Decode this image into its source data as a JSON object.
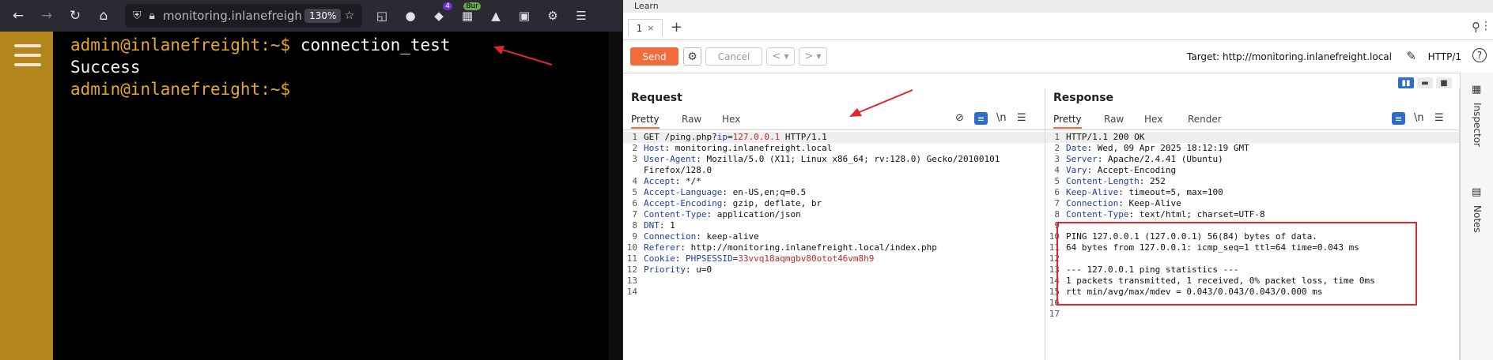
{
  "firefox": {
    "url": "monitoring.inlanefreigh",
    "zoom": "130%",
    "extensions": {
      "badge_count": "4",
      "burp_badge": "Bur"
    }
  },
  "terminal": {
    "lines": [
      {
        "prompt": "admin@inlanefreight:~$",
        "command": "connection_test"
      },
      {
        "output": "Success"
      },
      {
        "prompt": "admin@inlanefreight:~$",
        "command": ""
      }
    ]
  },
  "burp": {
    "learn_tab": "Learn",
    "repeater_tab": {
      "label": "1",
      "close": "×"
    },
    "add_tab": "+",
    "actions": {
      "send": "Send",
      "cancel": "Cancel",
      "prev": "<",
      "next": ">",
      "target": "Target: http://monitoring.inlanefreight.local",
      "protocol": "HTTP/1",
      "help": "?"
    },
    "request": {
      "title": "Request",
      "tabs": [
        "Pretty",
        "Raw",
        "Hex"
      ],
      "newline_toggle": "\\n",
      "lines": [
        {
          "n": "1",
          "parts": [
            {
              "t": "GET /ping.php?",
              "c": "val"
            },
            {
              "t": "ip",
              "c": "hdr"
            },
            {
              "t": "=",
              "c": "val"
            },
            {
              "t": "127.0.0.1",
              "c": "red"
            },
            {
              "t": " HTTP/1.1",
              "c": "val"
            }
          ]
        },
        {
          "n": "2",
          "parts": [
            {
              "t": "Host",
              "c": "hdr"
            },
            {
              "t": ": monitoring.inlanefreight.local",
              "c": "val"
            }
          ]
        },
        {
          "n": "3",
          "parts": [
            {
              "t": "User-Agent",
              "c": "hdr"
            },
            {
              "t": ": Mozilla/5.0 (X11; Linux x86_64; rv:128.0) Gecko/20100101",
              "c": "val"
            }
          ]
        },
        {
          "n": "",
          "parts": [
            {
              "t": "Firefox/128.0",
              "c": "val"
            }
          ]
        },
        {
          "n": "4",
          "parts": [
            {
              "t": "Accept",
              "c": "hdr"
            },
            {
              "t": ": */*",
              "c": "val"
            }
          ]
        },
        {
          "n": "5",
          "parts": [
            {
              "t": "Accept-Language",
              "c": "hdr"
            },
            {
              "t": ": en-US,en;q=0.5",
              "c": "val"
            }
          ]
        },
        {
          "n": "6",
          "parts": [
            {
              "t": "Accept-Encoding",
              "c": "hdr"
            },
            {
              "t": ": gzip, deflate, br",
              "c": "val"
            }
          ]
        },
        {
          "n": "7",
          "parts": [
            {
              "t": "Content-Type",
              "c": "hdr"
            },
            {
              "t": ": application/json",
              "c": "val"
            }
          ]
        },
        {
          "n": "8",
          "parts": [
            {
              "t": "DNT",
              "c": "hdr"
            },
            {
              "t": ": 1",
              "c": "val"
            }
          ]
        },
        {
          "n": "9",
          "parts": [
            {
              "t": "Connection",
              "c": "hdr"
            },
            {
              "t": ": keep-alive",
              "c": "val"
            }
          ]
        },
        {
          "n": "10",
          "parts": [
            {
              "t": "Referer",
              "c": "hdr"
            },
            {
              "t": ": http://monitoring.inlanefreight.local/index.php",
              "c": "val"
            }
          ]
        },
        {
          "n": "11",
          "parts": [
            {
              "t": "Cookie",
              "c": "hdr"
            },
            {
              "t": ": ",
              "c": "val"
            },
            {
              "t": "PHPSESSID",
              "c": "hdr"
            },
            {
              "t": "=",
              "c": "val"
            },
            {
              "t": "33vvq18aqmgbv80otot46vm8h9",
              "c": "red"
            }
          ]
        },
        {
          "n": "12",
          "parts": [
            {
              "t": "Priority",
              "c": "hdr"
            },
            {
              "t": ": u=0",
              "c": "val"
            }
          ]
        },
        {
          "n": "13",
          "parts": []
        },
        {
          "n": "14",
          "parts": []
        }
      ]
    },
    "response": {
      "title": "Response",
      "tabs": [
        "Pretty",
        "Raw",
        "Hex",
        "Render"
      ],
      "newline_toggle": "\\n",
      "lines": [
        {
          "n": "1",
          "parts": [
            {
              "t": "HTTP/1.1 200 OK",
              "c": "val"
            }
          ]
        },
        {
          "n": "2",
          "parts": [
            {
              "t": "Date",
              "c": "hdr"
            },
            {
              "t": ": Wed, 09 Apr 2025 18:12:19 GMT",
              "c": "val"
            }
          ]
        },
        {
          "n": "3",
          "parts": [
            {
              "t": "Server",
              "c": "hdr"
            },
            {
              "t": ": Apache/2.4.41 (Ubuntu)",
              "c": "val"
            }
          ]
        },
        {
          "n": "4",
          "parts": [
            {
              "t": "Vary",
              "c": "hdr"
            },
            {
              "t": ": Accept-Encoding",
              "c": "val"
            }
          ]
        },
        {
          "n": "5",
          "parts": [
            {
              "t": "Content-Length",
              "c": "hdr"
            },
            {
              "t": ": 252",
              "c": "val"
            }
          ]
        },
        {
          "n": "6",
          "parts": [
            {
              "t": "Keep-Alive",
              "c": "hdr"
            },
            {
              "t": ": timeout=5, max=100",
              "c": "val"
            }
          ]
        },
        {
          "n": "7",
          "parts": [
            {
              "t": "Connection",
              "c": "hdr"
            },
            {
              "t": ": Keep-Alive",
              "c": "val"
            }
          ]
        },
        {
          "n": "8",
          "parts": [
            {
              "t": "Content-Type",
              "c": "hdr"
            },
            {
              "t": ": text/html; charset=UTF-8",
              "c": "val"
            }
          ]
        },
        {
          "n": "9",
          "parts": []
        },
        {
          "n": "10",
          "parts": [
            {
              "t": "PING 127.0.0.1 (127.0.0.1) 56(84) bytes of data.",
              "c": "val"
            }
          ]
        },
        {
          "n": "11",
          "parts": [
            {
              "t": "64 bytes from 127.0.0.1: icmp_seq=1 ttl=64 time=0.043 ms",
              "c": "val"
            }
          ]
        },
        {
          "n": "12",
          "parts": []
        },
        {
          "n": "13",
          "parts": [
            {
              "t": "--- 127.0.0.1 ping statistics ---",
              "c": "val"
            }
          ]
        },
        {
          "n": "14",
          "parts": [
            {
              "t": "1 packets transmitted, 1 received, 0% packet loss, time 0ms",
              "c": "val"
            }
          ]
        },
        {
          "n": "15",
          "parts": [
            {
              "t": "rtt min/avg/max/mdev = 0.043/0.043/0.043/0.000 ms",
              "c": "val"
            }
          ]
        },
        {
          "n": "16",
          "parts": []
        },
        {
          "n": "17",
          "parts": []
        }
      ]
    },
    "sidebar": {
      "inspector": "Inspector",
      "notes": "Notes"
    }
  },
  "colors": {
    "send": "#f26b3a",
    "highlight_box": "#e0262e",
    "prompt": "#e5a827",
    "sidebar": "#b3851d"
  }
}
